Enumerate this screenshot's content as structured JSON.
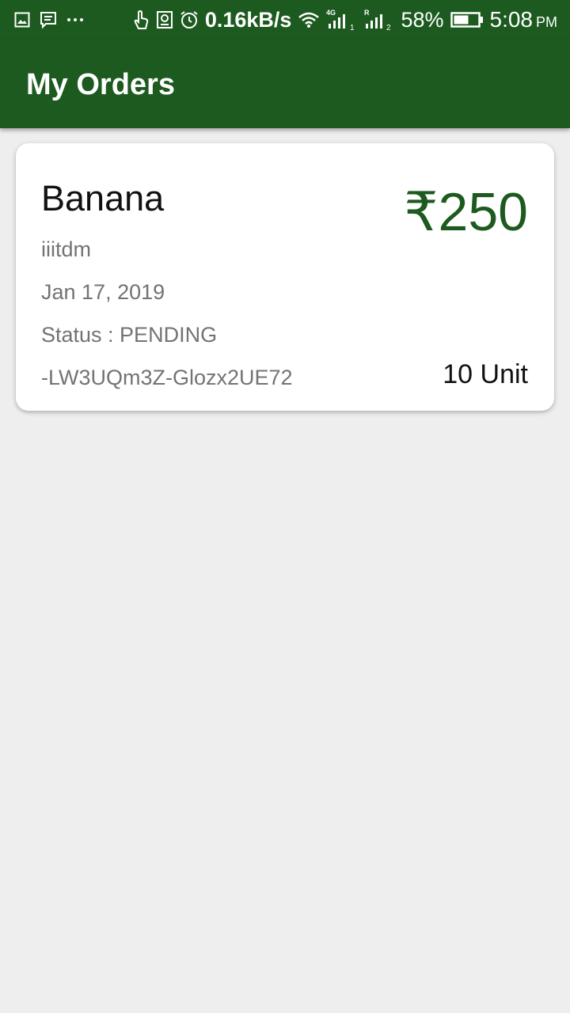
{
  "status_bar": {
    "speed": "0.16kB/s",
    "network_1_label": "4G",
    "sim1_index": "1",
    "roaming_label": "R",
    "sim2_index": "2",
    "battery": "58%",
    "time": "5:08",
    "ampm": "PM"
  },
  "app_bar": {
    "title": "My Orders"
  },
  "orders": [
    {
      "product": "Banana",
      "price": "₹250",
      "seller": "iiitdm",
      "date": "Jan 17, 2019",
      "status": "Status : PENDING",
      "order_id": "-LW3UQm3Z-Glozx2UE72",
      "quantity": "10",
      "unit": "Unit"
    }
  ],
  "colors": {
    "primary": "#1d5a1f",
    "background": "#eeeeee",
    "card": "#ffffff",
    "secondary_text": "#737373"
  },
  "icons": [
    "gallery-notification-icon",
    "message-notification-icon",
    "more-notifications-icon",
    "touch-icon",
    "screenshot-icon",
    "alarm-icon",
    "wifi-icon",
    "signal-icon",
    "battery-icon"
  ]
}
